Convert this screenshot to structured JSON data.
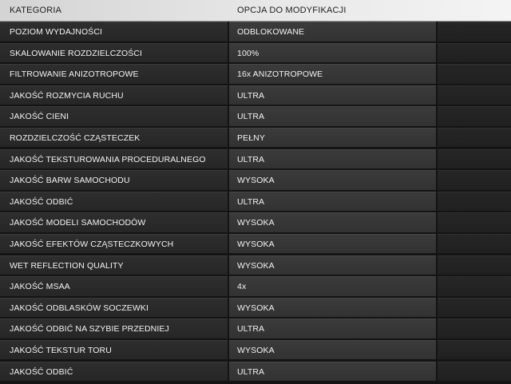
{
  "header": {
    "category_label": "KATEGORIA",
    "option_label": "OPCJA DO MODYFIKACJI"
  },
  "rows": [
    {
      "category": "POZIOM WYDAJNOŚCI",
      "value": "ODBLOKOWANE"
    },
    {
      "category": "SKALOWANIE ROZDZIELCZOŚCI",
      "value": "100%"
    },
    {
      "category": "FILTROWANIE ANIZOTROPOWE",
      "value": "16x ANIZOTROPOWE"
    },
    {
      "category": "JAKOŚĆ ROZMYCIA RUCHU",
      "value": "ULTRA"
    },
    {
      "category": "JAKOŚĆ CIENI",
      "value": "ULTRA"
    },
    {
      "category": "ROZDZIELCZOŚĆ CZĄSTECZEK",
      "value": "PEŁNY"
    },
    {
      "category": "JAKOŚĆ TEKSTUROWANIA PROCEDURALNEGO",
      "value": "ULTRA"
    },
    {
      "category": "JAKOŚĆ BARW SAMOCHODU",
      "value": "WYSOKA"
    },
    {
      "category": "JAKOŚĆ ODBIĆ",
      "value": "ULTRA"
    },
    {
      "category": "JAKOŚĆ MODELI SAMOCHODÓW",
      "value": "WYSOKA"
    },
    {
      "category": "JAKOŚĆ EFEKTÓW CZĄSTECZKOWYCH",
      "value": "WYSOKA"
    },
    {
      "category": "WET REFLECTION QUALITY",
      "value": "WYSOKA"
    },
    {
      "category": "JAKOŚĆ MSAA",
      "value": "4x"
    },
    {
      "category": "JAKOŚĆ ODBLASKÓW SOCZEWKI",
      "value": "WYSOKA"
    },
    {
      "category": "JAKOŚĆ ODBIĆ NA SZYBIE PRZEDNIEJ",
      "value": "ULTRA"
    },
    {
      "category": "JAKOŚĆ TEKSTUR TORU",
      "value": "WYSOKA"
    },
    {
      "category": "JAKOŚĆ ODBIĆ",
      "value": "ULTRA"
    }
  ]
}
